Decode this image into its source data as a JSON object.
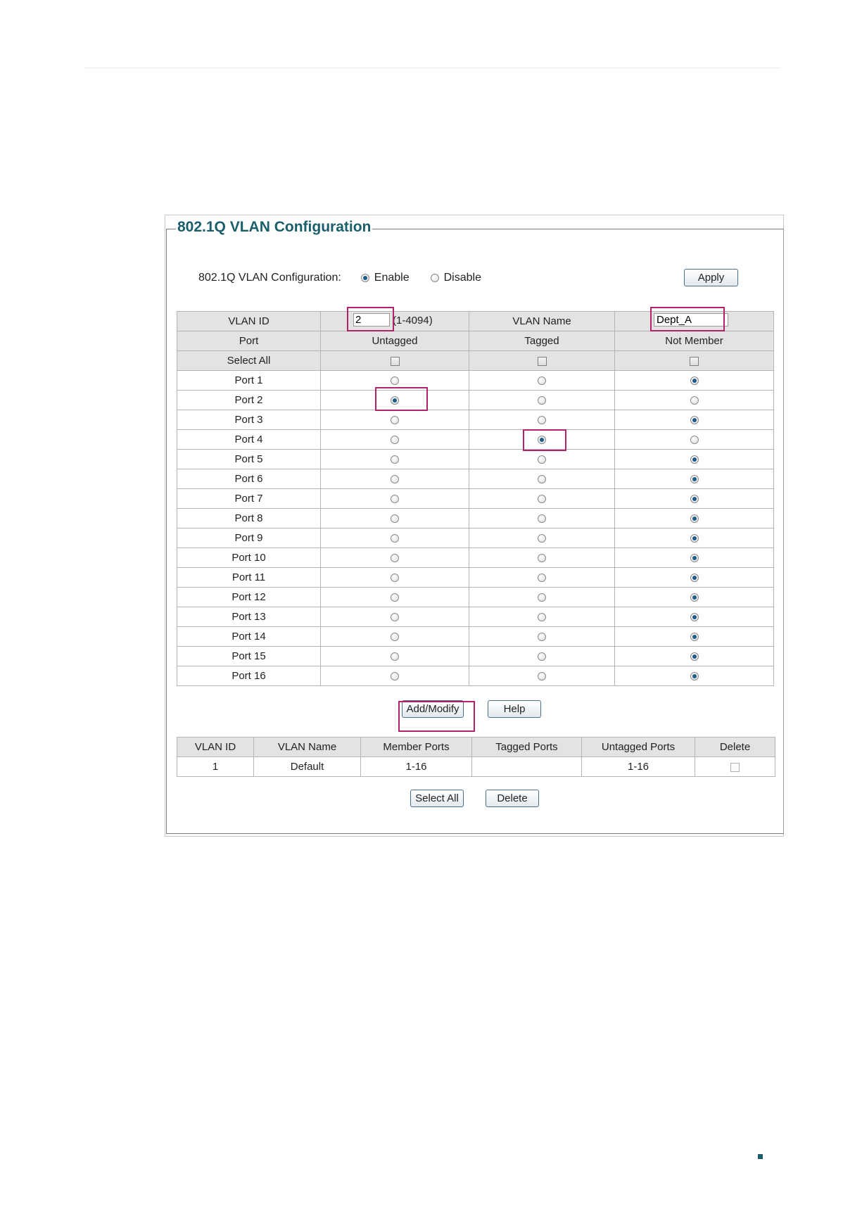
{
  "panel": {
    "title": "802.1Q VLAN Configuration",
    "config_label": "802.1Q VLAN Configuration:",
    "enable_label": "Enable",
    "disable_label": "Disable",
    "mode": "Enable",
    "apply_label": "Apply"
  },
  "form": {
    "vlan_id_label": "VLAN ID",
    "vlan_id_value": "2",
    "vlan_id_range": "(1-4094)",
    "vlan_name_label": "VLAN Name",
    "vlan_name_value": "Dept_A",
    "col_port": "Port",
    "col_untagged": "Untagged",
    "col_tagged": "Tagged",
    "col_not_member": "Not Member",
    "select_all_label": "Select All"
  },
  "ports": [
    {
      "name": "Port 1",
      "membership": "not_member"
    },
    {
      "name": "Port 2",
      "membership": "untagged"
    },
    {
      "name": "Port 3",
      "membership": "not_member"
    },
    {
      "name": "Port 4",
      "membership": "tagged"
    },
    {
      "name": "Port 5",
      "membership": "not_member"
    },
    {
      "name": "Port 6",
      "membership": "not_member"
    },
    {
      "name": "Port 7",
      "membership": "not_member"
    },
    {
      "name": "Port 8",
      "membership": "not_member"
    },
    {
      "name": "Port 9",
      "membership": "not_member"
    },
    {
      "name": "Port 10",
      "membership": "not_member"
    },
    {
      "name": "Port 11",
      "membership": "not_member"
    },
    {
      "name": "Port 12",
      "membership": "not_member"
    },
    {
      "name": "Port 13",
      "membership": "not_member"
    },
    {
      "name": "Port 14",
      "membership": "not_member"
    },
    {
      "name": "Port 15",
      "membership": "not_member"
    },
    {
      "name": "Port 16",
      "membership": "not_member"
    }
  ],
  "actions": {
    "add_modify_label": "Add/Modify",
    "help_label": "Help",
    "select_all_label": "Select All",
    "delete_label": "Delete"
  },
  "vlan_table": {
    "headers": [
      "VLAN ID",
      "VLAN Name",
      "Member Ports",
      "Tagged Ports",
      "Untagged Ports",
      "Delete"
    ],
    "rows": [
      {
        "vlan_id": "1",
        "vlan_name": "Default",
        "member_ports": "1-16",
        "tagged_ports": "",
        "untagged_ports": "1-16"
      }
    ]
  },
  "colors": {
    "title": "#1a5e6a",
    "highlight": "#b0236a",
    "radio_selected": "#1c5d8a"
  }
}
